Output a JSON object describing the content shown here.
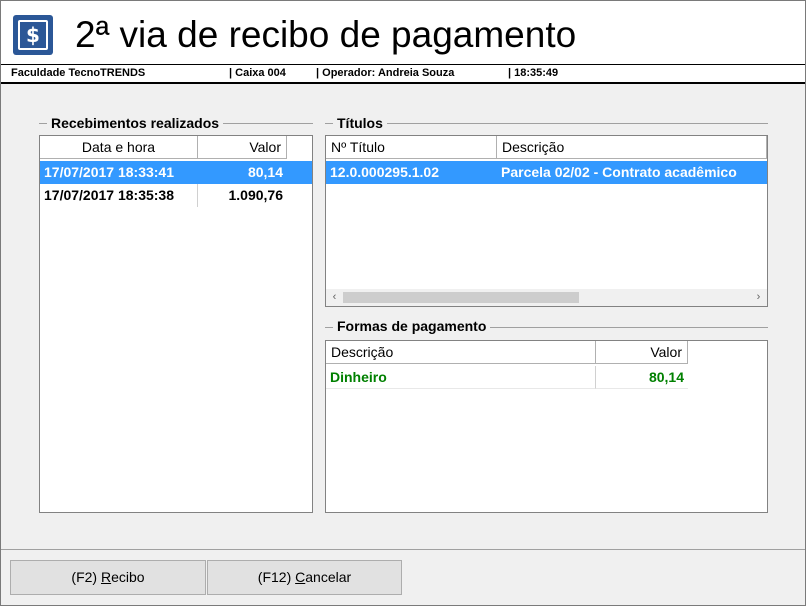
{
  "header": {
    "icon": "dollar-icon",
    "title": "2ª via de recibo de pagamento"
  },
  "infobar": {
    "institution": "Faculdade TecnoTRENDS",
    "caixa": "| Caixa 004",
    "operador": "| Operador: Andreia Souza",
    "time": "| 18:35:49"
  },
  "recebimentos": {
    "label": "Recebimentos realizados",
    "columns": [
      "Data e hora",
      "Valor"
    ],
    "rows": [
      {
        "datetime": "17/07/2017 18:33:41",
        "valor": "80,14"
      },
      {
        "datetime": "17/07/2017 18:35:38",
        "valor": "1.090,76"
      }
    ]
  },
  "titulos": {
    "label": "Títulos",
    "columns": [
      "Nº Título",
      "Descrição"
    ],
    "rows": [
      {
        "numero": "12.0.000295.1.02",
        "descricao": "Parcela 02/02 - Contrato acadêmico"
      }
    ],
    "scroll_left": "‹",
    "scroll_right": "›"
  },
  "formas": {
    "label": "Formas de pagamento",
    "columns": [
      "Descrição",
      "Valor"
    ],
    "rows": [
      {
        "descricao": "Dinheiro",
        "valor": "80,14"
      }
    ]
  },
  "buttons": {
    "recibo_prefix": "(F2) ",
    "recibo_key": "R",
    "recibo_rest": "ecibo",
    "cancelar_prefix": "(F12) ",
    "cancelar_key": "C",
    "cancelar_rest": "ancelar"
  },
  "colors": {
    "selection": "#3399ff",
    "logo": "#2b5797",
    "green_text": "#008000"
  }
}
